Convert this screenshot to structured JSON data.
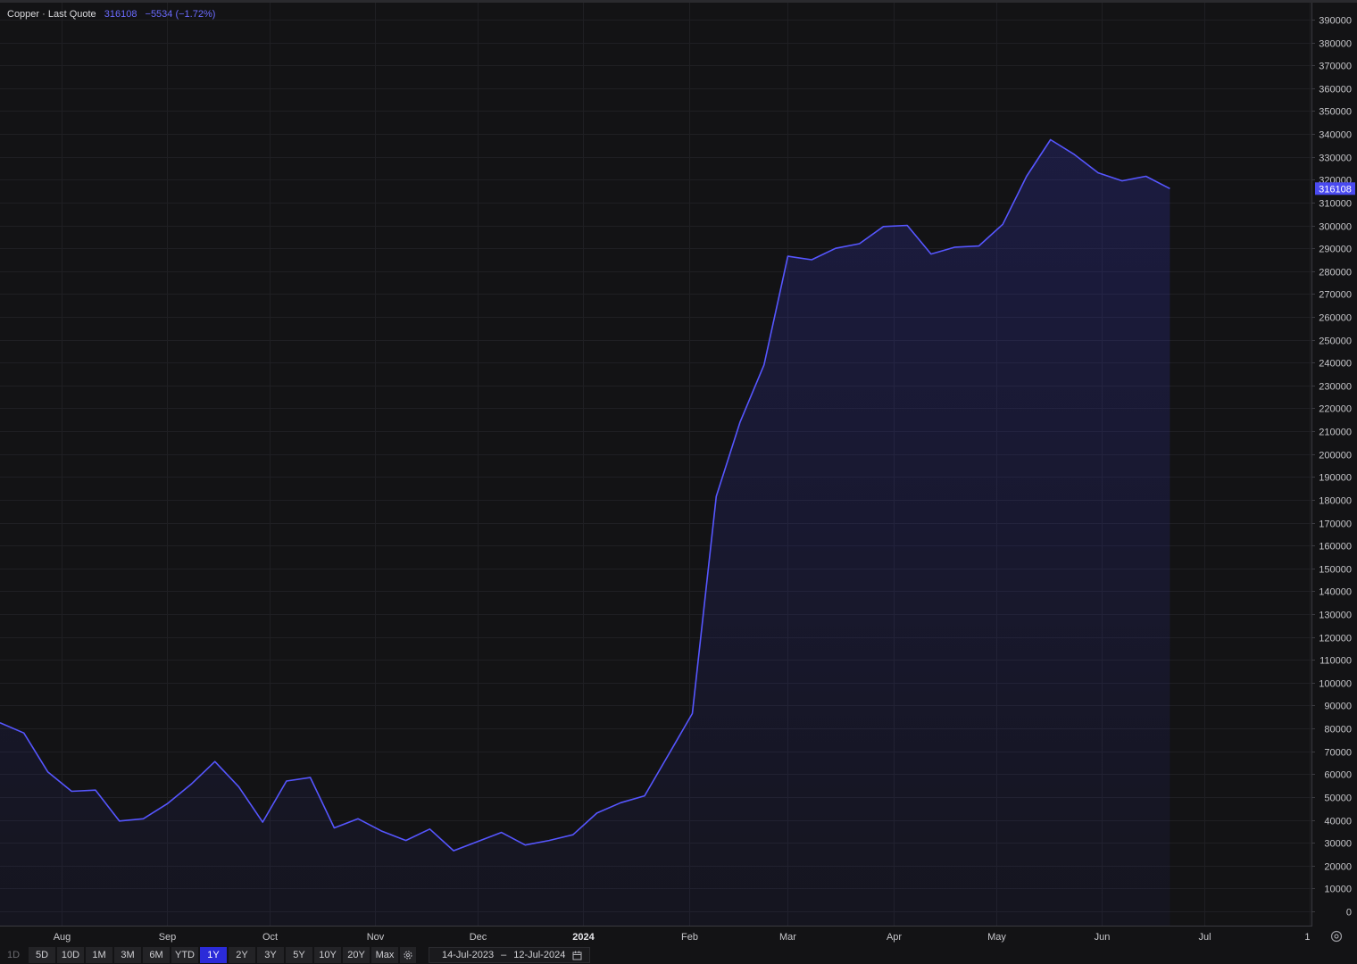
{
  "legend": {
    "name": "Copper · Last Quote",
    "last_value": "316108",
    "change": "−5534 (−1.72%)"
  },
  "price_tag": "316108",
  "colors": {
    "background": "#131315",
    "line": "#5656ff",
    "price_tag": "#4a4af0",
    "active_range": "#2b2bd9"
  },
  "chart_data": {
    "type": "area",
    "title": "",
    "xlabel": "",
    "ylabel": "",
    "ylim": [
      0,
      390000
    ],
    "yticks": [
      0,
      10000,
      20000,
      30000,
      40000,
      50000,
      60000,
      70000,
      80000,
      90000,
      100000,
      110000,
      120000,
      130000,
      140000,
      150000,
      160000,
      170000,
      180000,
      190000,
      200000,
      210000,
      220000,
      230000,
      240000,
      250000,
      260000,
      270000,
      280000,
      290000,
      300000,
      310000,
      320000,
      330000,
      340000,
      350000,
      360000,
      370000,
      380000,
      390000
    ],
    "xlim": [
      "2023-07-14",
      "2024-08-01"
    ],
    "xticks": [
      {
        "label": "Aug",
        "date": "2023-08-01",
        "bold": false
      },
      {
        "label": "Sep",
        "date": "2023-09-01",
        "bold": false
      },
      {
        "label": "Oct",
        "date": "2023-10-01",
        "bold": false
      },
      {
        "label": "Nov",
        "date": "2023-11-01",
        "bold": false
      },
      {
        "label": "Dec",
        "date": "2023-12-01",
        "bold": false
      },
      {
        "label": "2024",
        "date": "2024-01-01",
        "bold": true
      },
      {
        "label": "Feb",
        "date": "2024-02-01",
        "bold": false
      },
      {
        "label": "Mar",
        "date": "2024-03-01",
        "bold": false
      },
      {
        "label": "Apr",
        "date": "2024-04-01",
        "bold": false
      },
      {
        "label": "May",
        "date": "2024-05-01",
        "bold": false
      },
      {
        "label": "Jun",
        "date": "2024-06-01",
        "bold": false
      },
      {
        "label": "Jul",
        "date": "2024-07-01",
        "bold": false
      },
      {
        "label": "1",
        "date": "2024-08-01",
        "bold": false
      }
    ],
    "grid": true,
    "series": [
      {
        "points": [
          [
            "2023-07-14",
            82500
          ],
          [
            "2023-07-21",
            78000
          ],
          [
            "2023-07-28",
            61000
          ],
          [
            "2023-08-04",
            52500
          ],
          [
            "2023-08-11",
            53000
          ],
          [
            "2023-08-18",
            39500
          ],
          [
            "2023-08-25",
            40500
          ],
          [
            "2023-09-01",
            47000
          ],
          [
            "2023-09-08",
            55500
          ],
          [
            "2023-09-15",
            65500
          ],
          [
            "2023-09-22",
            54500
          ],
          [
            "2023-09-29",
            39000
          ],
          [
            "2023-10-06",
            57000
          ],
          [
            "2023-10-13",
            58500
          ],
          [
            "2023-10-20",
            36500
          ],
          [
            "2023-10-27",
            40500
          ],
          [
            "2023-11-03",
            35000
          ],
          [
            "2023-11-10",
            31000
          ],
          [
            "2023-11-17",
            36000
          ],
          [
            "2023-11-24",
            26500
          ],
          [
            "2023-12-01",
            30500
          ],
          [
            "2023-12-08",
            34500
          ],
          [
            "2023-12-15",
            29000
          ],
          [
            "2023-12-22",
            31000
          ],
          [
            "2023-12-29",
            33500
          ],
          [
            "2024-01-05",
            43000
          ],
          [
            "2024-01-12",
            47500
          ],
          [
            "2024-01-19",
            50500
          ],
          [
            "2024-01-26",
            68500
          ],
          [
            "2024-02-02",
            86500
          ],
          [
            "2024-02-09",
            181500
          ],
          [
            "2024-02-16",
            214000
          ],
          [
            "2024-02-23",
            239000
          ],
          [
            "2024-03-01",
            286500
          ],
          [
            "2024-03-08",
            285000
          ],
          [
            "2024-03-15",
            290000
          ],
          [
            "2024-03-22",
            292000
          ],
          [
            "2024-03-29",
            299500
          ],
          [
            "2024-04-05",
            300000
          ],
          [
            "2024-04-12",
            287500
          ],
          [
            "2024-04-19",
            290500
          ],
          [
            "2024-04-26",
            291000
          ],
          [
            "2024-05-03",
            300500
          ],
          [
            "2024-05-10",
            321500
          ],
          [
            "2024-05-17",
            337500
          ],
          [
            "2024-05-24",
            331000
          ],
          [
            "2024-05-31",
            323000
          ],
          [
            "2024-06-07",
            319500
          ],
          [
            "2024-06-14",
            321500
          ],
          [
            "2024-06-21",
            316108
          ]
        ]
      }
    ]
  },
  "range_buttons": [
    "1D",
    "5D",
    "10D",
    "1M",
    "3M",
    "6M",
    "YTD",
    "1Y",
    "2Y",
    "3Y",
    "5Y",
    "10Y",
    "20Y",
    "Max"
  ],
  "active_range": "1Y",
  "date_range": {
    "start": "14-Jul-2023",
    "separator": "–",
    "end": "12-Jul-2024"
  }
}
